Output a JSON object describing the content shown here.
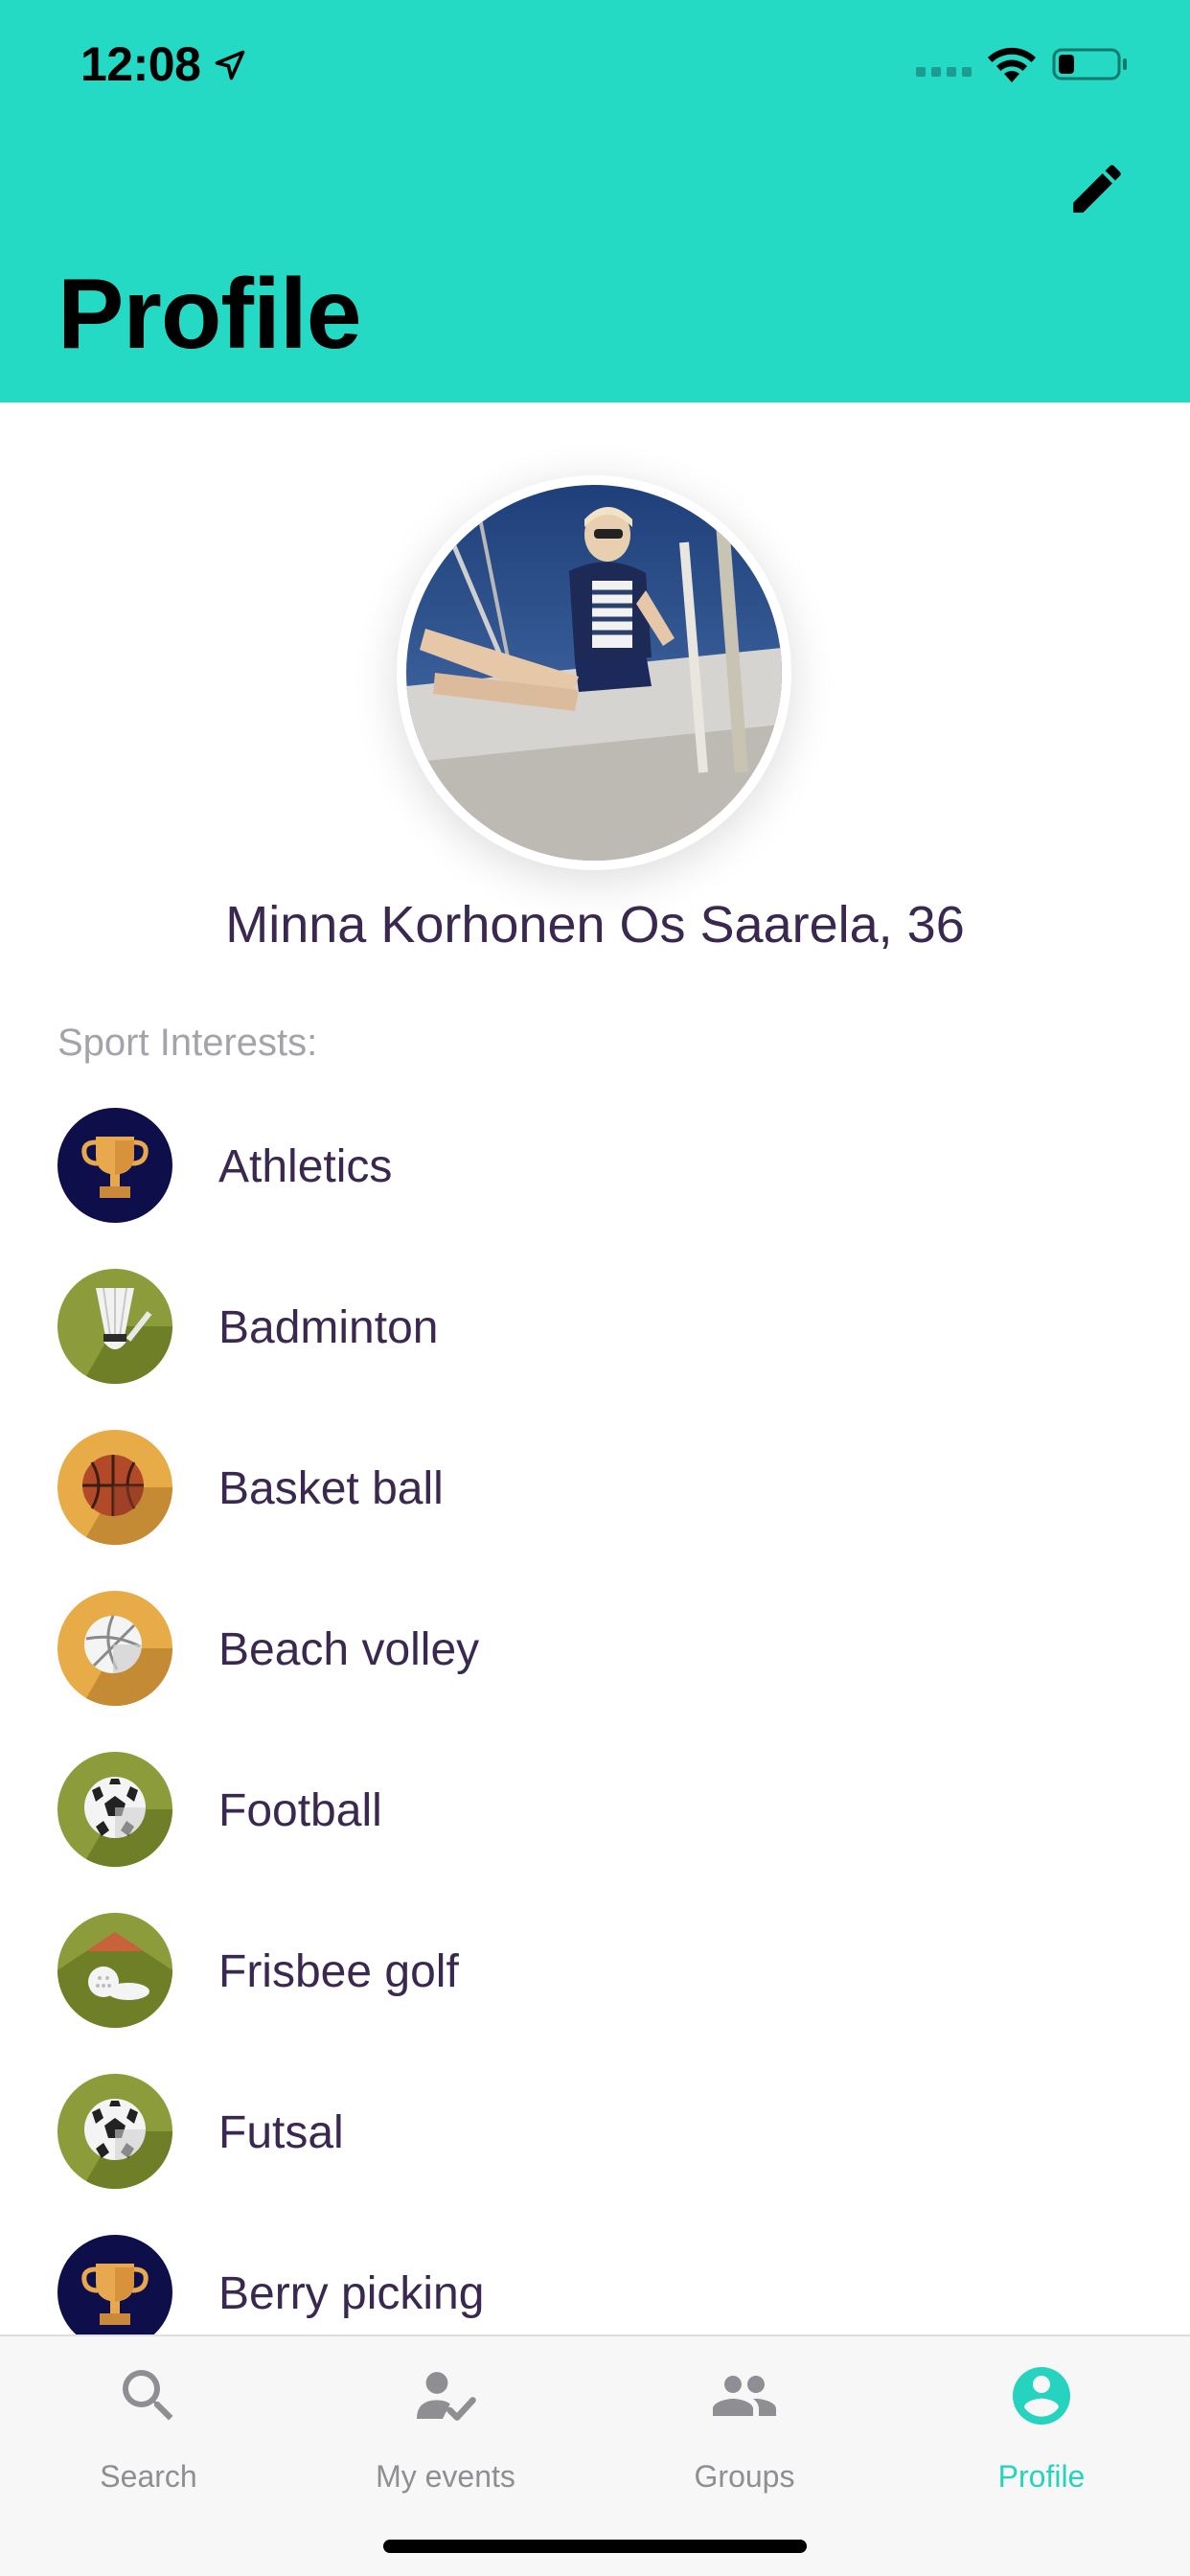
{
  "status_bar": {
    "time": "12:08"
  },
  "header": {
    "title": "Profile",
    "edit_icon": "pencil-icon",
    "background": "#25dac5"
  },
  "profile": {
    "name": "Minna Korhonen Os Saarela, 36",
    "section_label": "Sport Interests:"
  },
  "sports": [
    {
      "label": "Athletics",
      "icon": "trophy-icon",
      "color": "#0e0f4a"
    },
    {
      "label": "Badminton",
      "icon": "shuttlecock-icon",
      "color": "#8d9c3a"
    },
    {
      "label": "Basket ball",
      "icon": "basketball-icon",
      "color": "#e7ac48"
    },
    {
      "label": "Beach volley",
      "icon": "volleyball-icon",
      "color": "#e7ac48"
    },
    {
      "label": "Football",
      "icon": "soccer-ball-icon",
      "color": "#8d9c3a"
    },
    {
      "label": "Frisbee golf",
      "icon": "golf-ball-icon",
      "color": "#8d9c3a"
    },
    {
      "label": "Futsal",
      "icon": "soccer-ball-icon",
      "color": "#8d9c3a"
    },
    {
      "label": "Berry picking",
      "icon": "trophy-icon",
      "color": "#0e0f4a"
    }
  ],
  "tab_bar": {
    "tabs": [
      {
        "label": "Search",
        "icon": "search-icon"
      },
      {
        "label": "My events",
        "icon": "person-check-icon"
      },
      {
        "label": "Groups",
        "icon": "group-icon"
      },
      {
        "label": "Profile",
        "icon": "account-circle-icon"
      }
    ],
    "active": "Profile",
    "active_color": "#25d3be",
    "inactive_color": "#8e8e93"
  }
}
